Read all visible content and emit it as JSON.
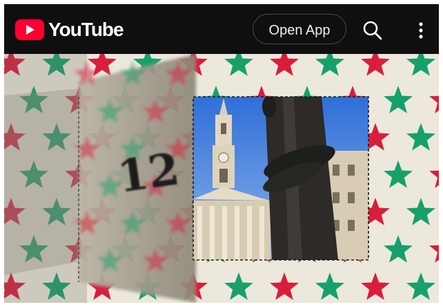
{
  "header": {
    "brand_name": "YouTube",
    "logo_icon": "youtube-play-icon",
    "open_app_label": "Open App",
    "search_icon": "search-icon",
    "more_icon": "more-vert-icon"
  },
  "video": {
    "door_number": "12"
  },
  "colors": {
    "header_bg": "#0f0f0f",
    "brand_red": "#ff0033",
    "star_red": "#d81e3c",
    "star_green": "#16a06c",
    "paper": "#ece8dc"
  }
}
